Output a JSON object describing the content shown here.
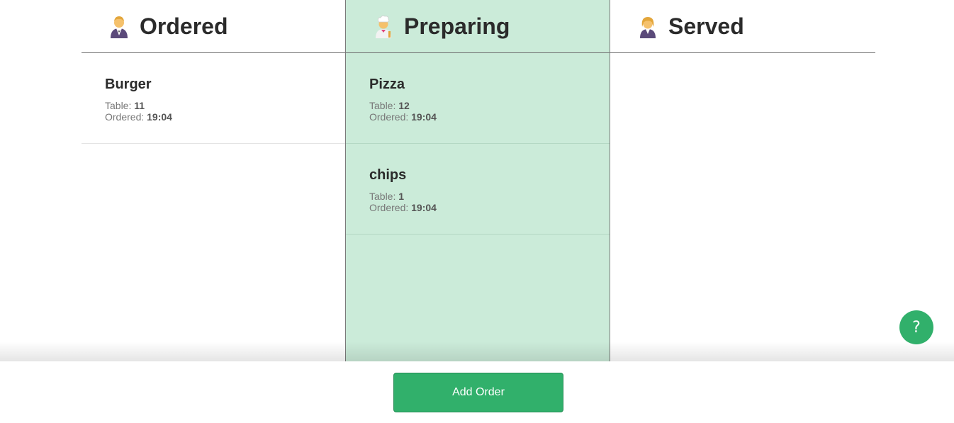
{
  "colors": {
    "accent": "#31b06b",
    "preparing_bg": "#cbebd9"
  },
  "columns": [
    {
      "title": "Ordered",
      "icon": "waiter-icon",
      "orders": [
        {
          "name": "Burger",
          "table_label": "Table: ",
          "table": "11",
          "ordered_label": "Ordered: ",
          "time": "19:04"
        }
      ]
    },
    {
      "title": "Preparing",
      "icon": "chef-icon",
      "orders": [
        {
          "name": "Pizza",
          "table_label": "Table: ",
          "table": "12",
          "ordered_label": "Ordered: ",
          "time": "19:04"
        },
        {
          "name": "chips",
          "table_label": "Table: ",
          "table": "1",
          "ordered_label": "Ordered: ",
          "time": "19:04"
        }
      ]
    },
    {
      "title": "Served",
      "icon": "server-icon",
      "orders": []
    }
  ],
  "footer": {
    "add_order_label": "Add Order"
  },
  "help": {
    "label": "?"
  }
}
